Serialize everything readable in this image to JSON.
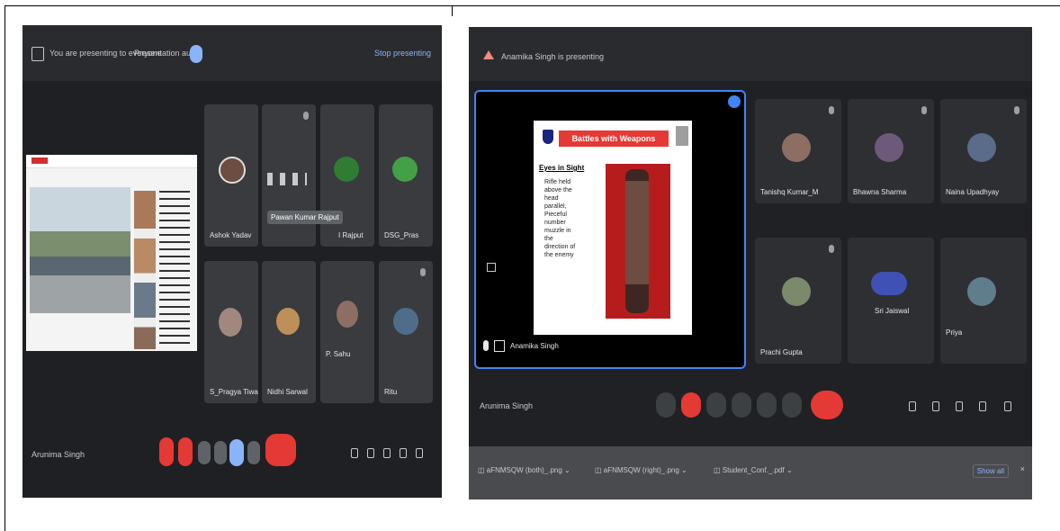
{
  "left_meeting": {
    "topbar": {
      "presenting_text": "You are presenting to everyone",
      "presentation_audio_label": "Presentation audio",
      "stop_presenting_label": "Stop presenting"
    },
    "tiles": [
      {
        "name": "Ashok Yadav"
      },
      {
        "name": "Pawan Kumar Rajput"
      },
      {
        "name": "I Rajput"
      },
      {
        "name": "DSG_Pras"
      },
      {
        "name": "S_Pragya Tiwari"
      },
      {
        "name": "Nidhi Sarwal"
      },
      {
        "name": "P. Sahu"
      },
      {
        "name": "Ritu"
      }
    ],
    "tooltip": "Pawan Kumar Rajput",
    "self_name": "Arunima Singh",
    "colors": {
      "end_call": "#e53935",
      "accent": "#8ab4f8"
    }
  },
  "right_meeting": {
    "topbar": {
      "presenting_text": "Anamika Singh is presenting"
    },
    "slide": {
      "title": "Battles with Weapons",
      "subtitle": "Eyes in Sight",
      "body_lines": [
        "Rifle held",
        "above the",
        "head",
        "parallel,",
        "Pieceful",
        "number",
        "muzzle in",
        "the",
        "direction of",
        "the enemy"
      ]
    },
    "presenter_name": "Anamika Singh",
    "tiles": [
      {
        "name": "Tanishq Kumar_M"
      },
      {
        "name": "Bhawna Sharma"
      },
      {
        "name": "Naina Upadhyay"
      },
      {
        "name": "Prachi Gupta"
      },
      {
        "name": "Sri Jaiswal"
      },
      {
        "name": "Priya"
      }
    ],
    "self_name": "Arunima Singh",
    "downloads": [
      {
        "label": "aFNMSQW (both)_.png"
      },
      {
        "label": "aFNMSQW (right)_.png"
      },
      {
        "label": "Student_Conf._.pdf"
      }
    ],
    "show_all_label": "Show all"
  }
}
